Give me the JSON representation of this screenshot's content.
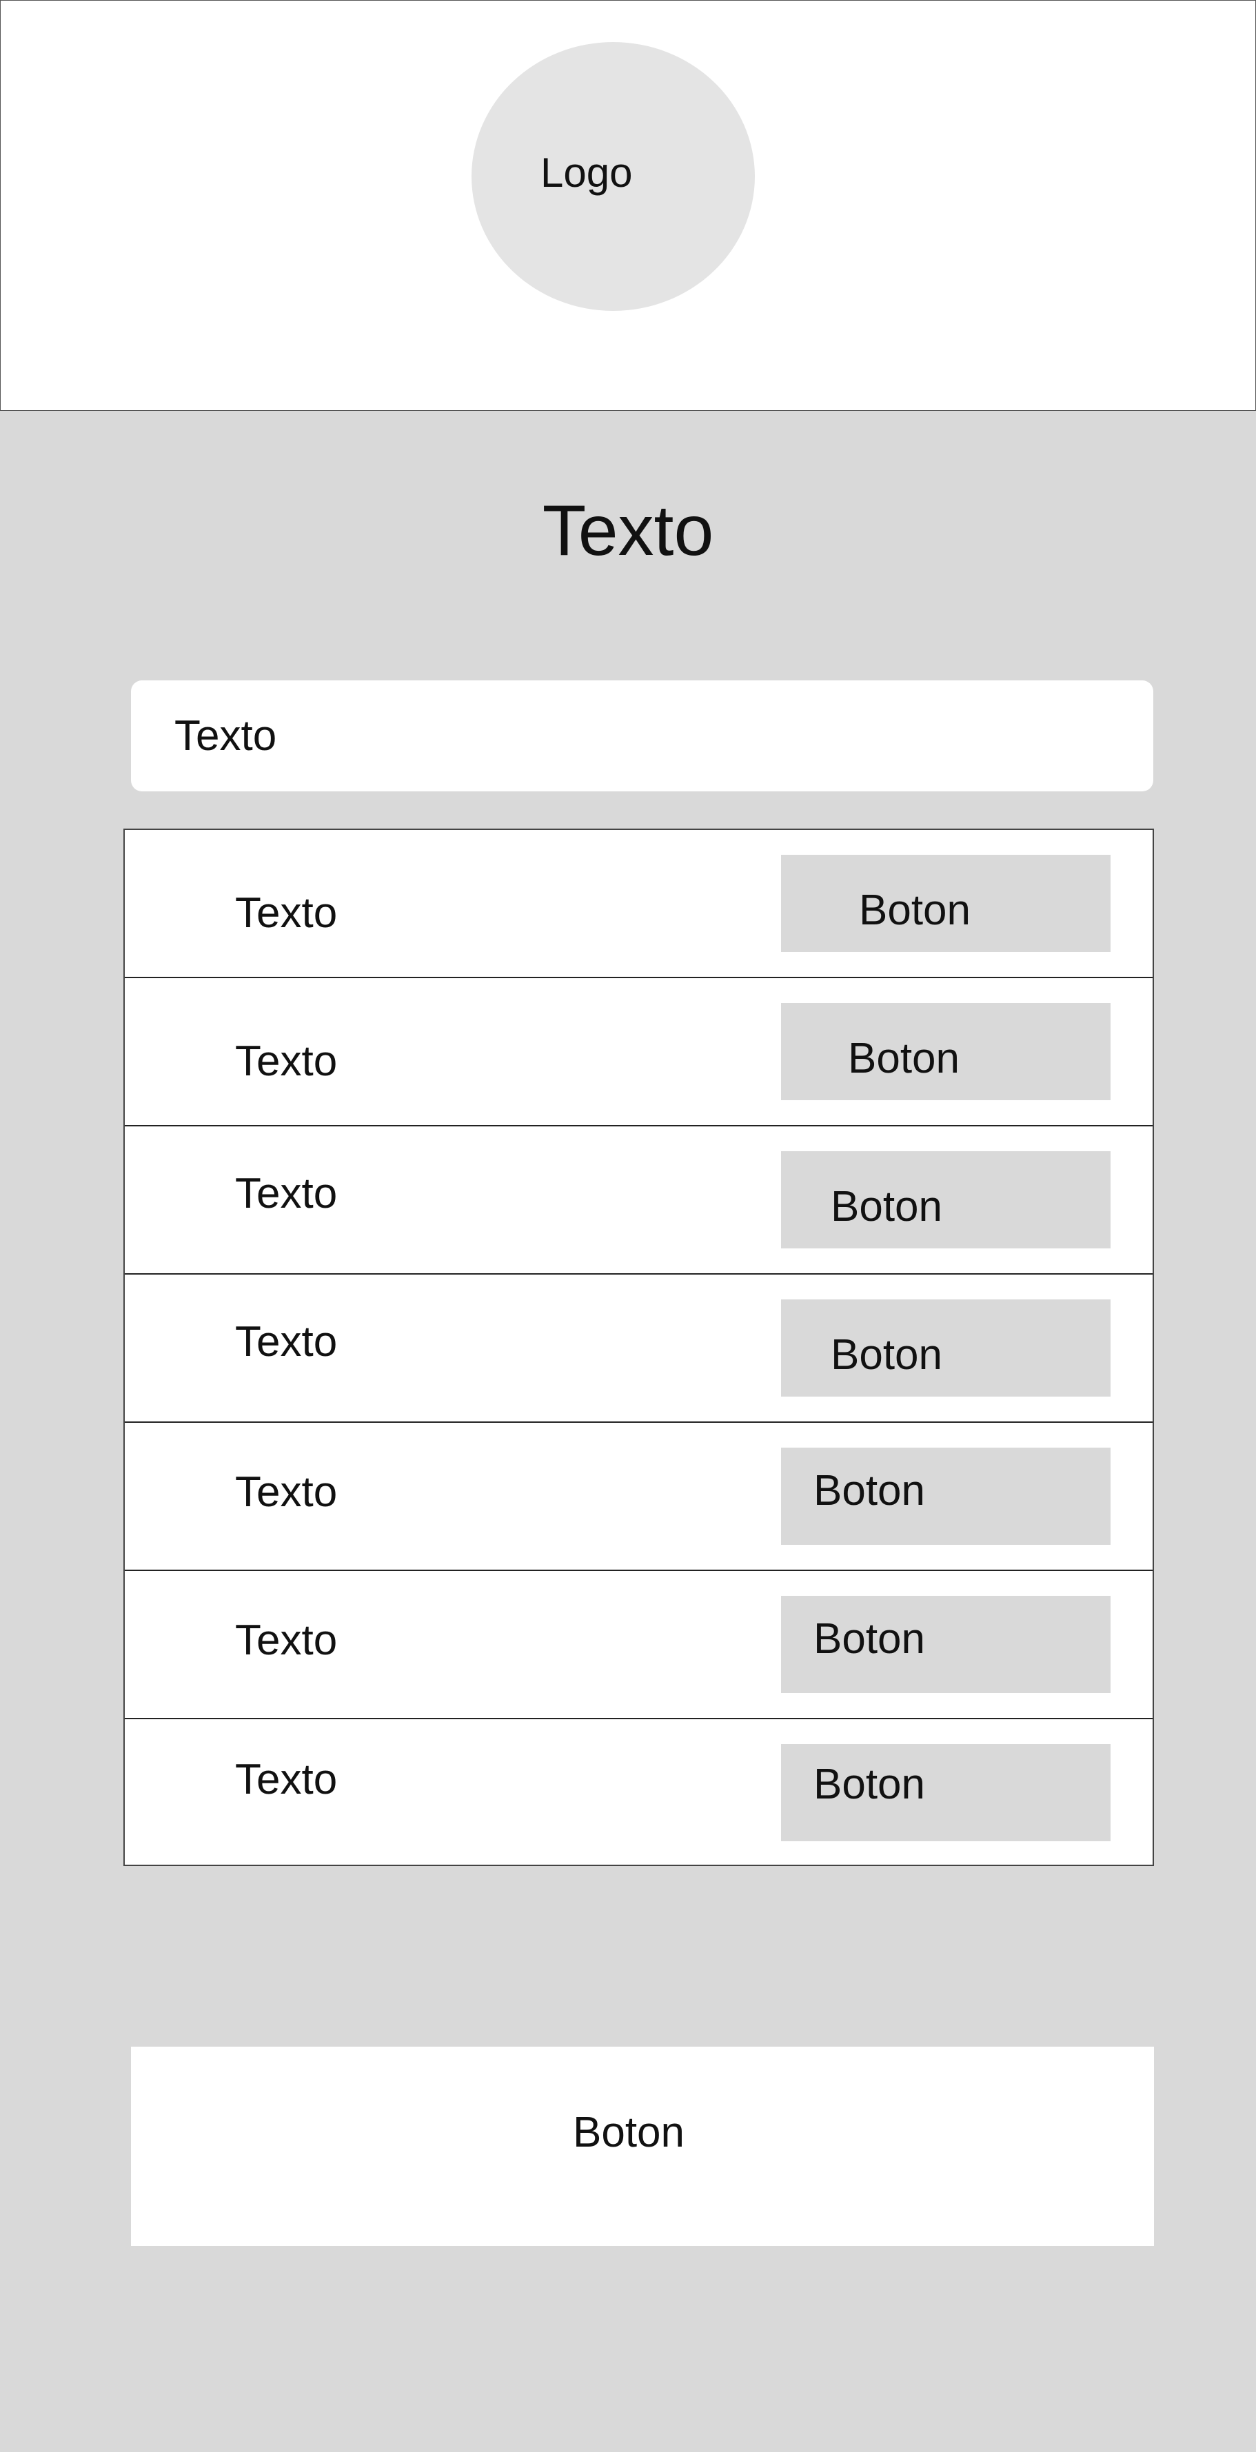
{
  "header": {
    "logo_label": "Logo"
  },
  "main": {
    "title": "Texto",
    "text_field": {
      "value": "Texto"
    },
    "list": {
      "rows": [
        {
          "text": "Texto",
          "button_label": "Boton"
        },
        {
          "text": "Texto",
          "button_label": "Boton"
        },
        {
          "text": "Texto",
          "button_label": "Boton"
        },
        {
          "text": "Texto",
          "button_label": "Boton"
        },
        {
          "text": "Texto",
          "button_label": "Boton"
        },
        {
          "text": "Texto",
          "button_label": "Boton"
        },
        {
          "text": "Texto",
          "button_label": "Boton"
        }
      ]
    },
    "bottom_button_label": "Boton"
  }
}
